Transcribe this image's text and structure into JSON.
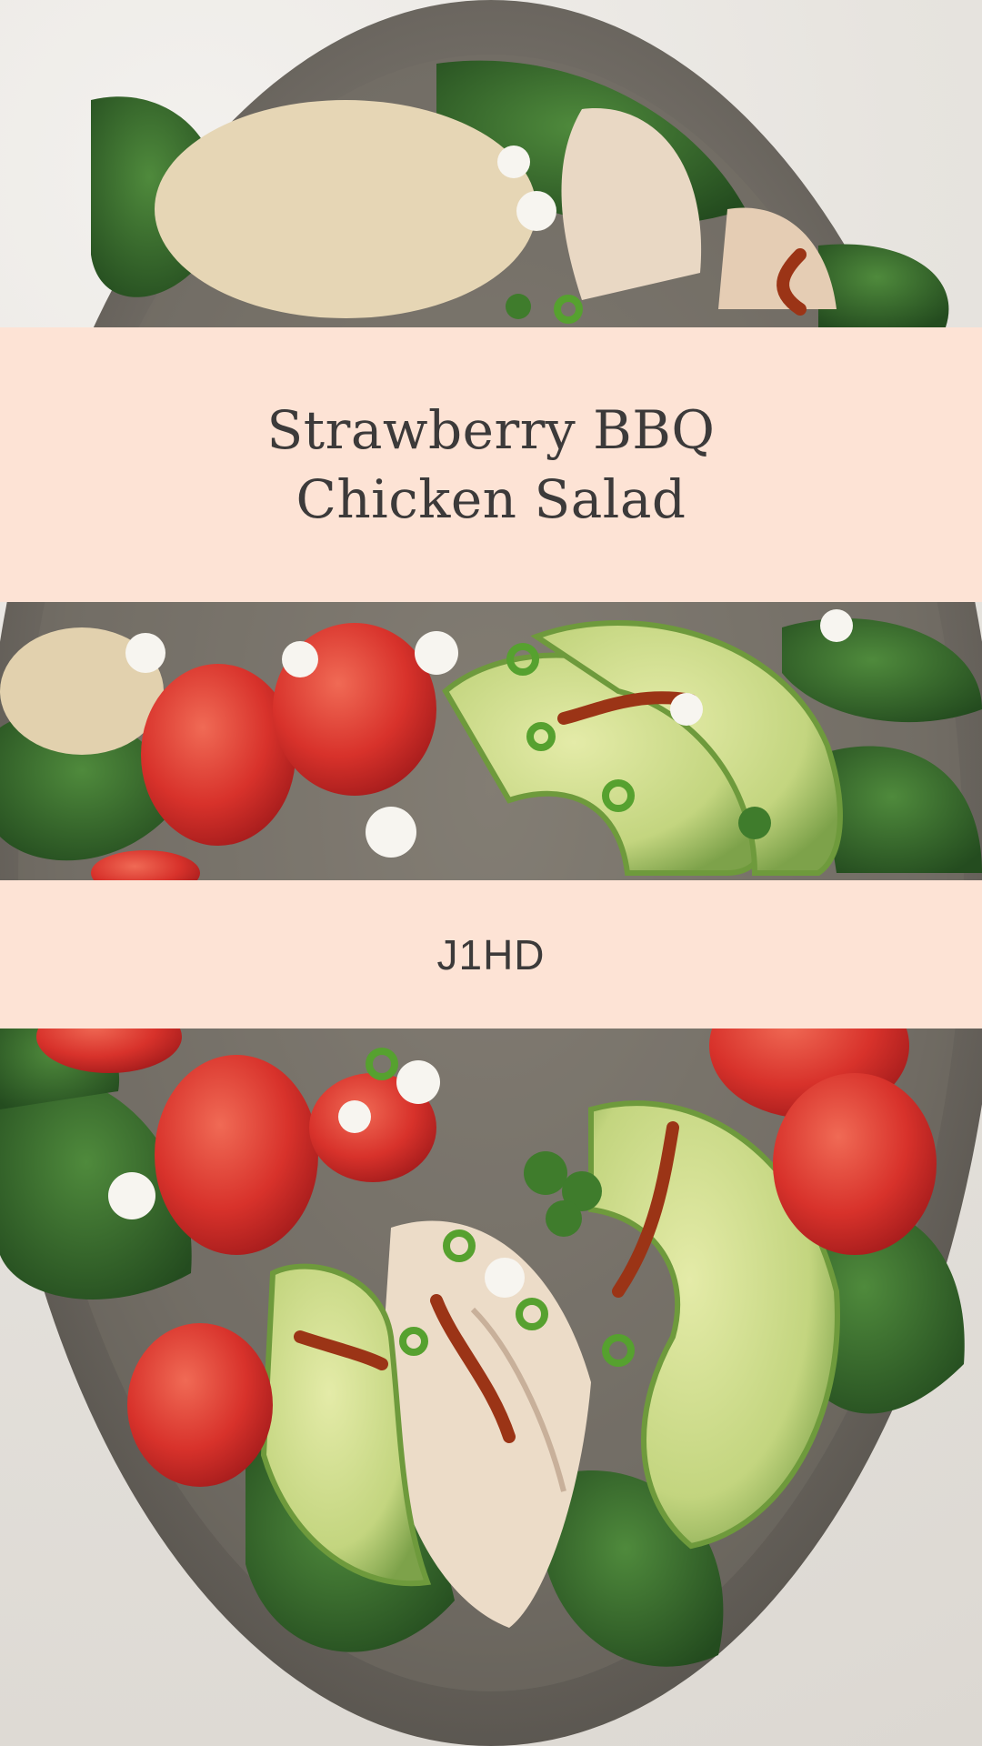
{
  "title": {
    "line1": "Strawberry BBQ",
    "line2": "Chicken Salad"
  },
  "code": "J1HD",
  "colors": {
    "band": "#fde3d5",
    "text": "#3c3a3a",
    "plate": "#6f6a63",
    "spinach": "#2f5a2a",
    "avocado": "#c7d98b",
    "strawberry": "#d8322b",
    "chicken": "#e9d8c4",
    "bbq_sauce": "#9b3416",
    "quinoa": "#e6d6b5"
  }
}
